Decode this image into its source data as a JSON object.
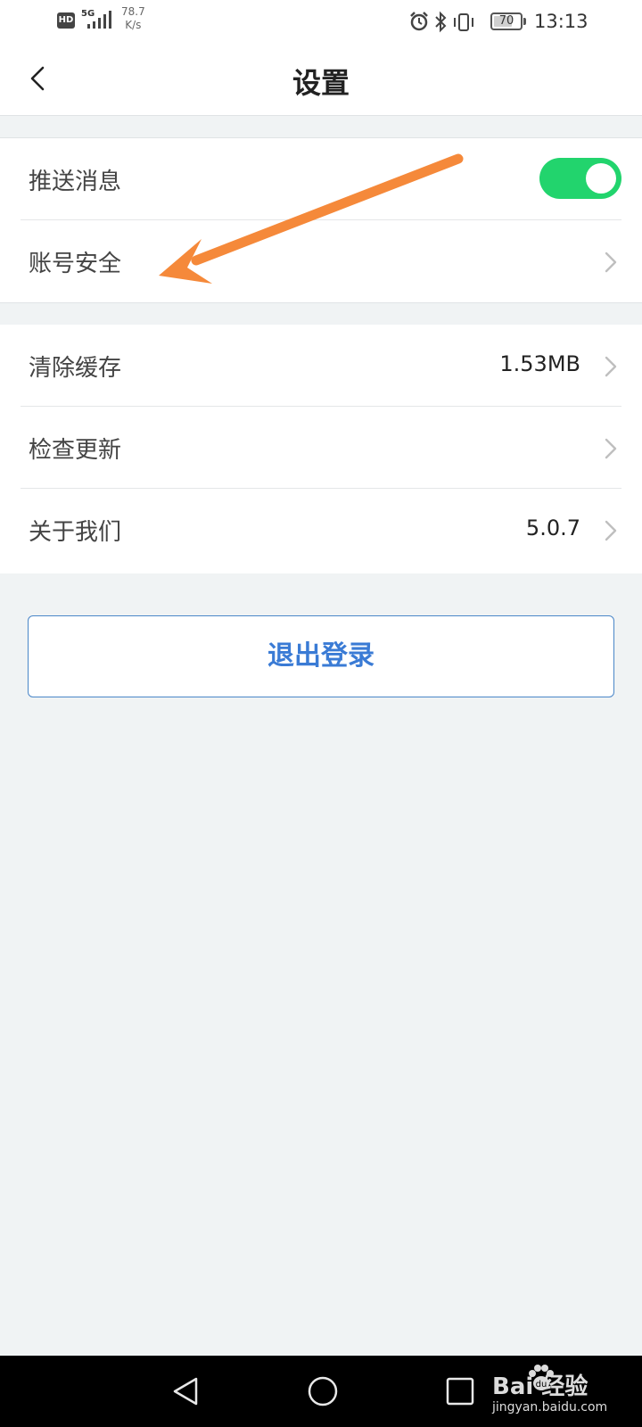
{
  "status_bar": {
    "hd": "HD",
    "network": "5G",
    "speed_value": "78.7",
    "speed_unit": "K/s",
    "battery_level": "70",
    "time": "13:13"
  },
  "header": {
    "title": "设置"
  },
  "settings_group_1": {
    "push_messages_label": "推送消息",
    "push_messages_enabled": true,
    "account_security_label": "账号安全"
  },
  "settings_group_2": {
    "clear_cache_label": "清除缓存",
    "cache_size": "1.53MB",
    "check_update_label": "检查更新",
    "about_label": "关于我们",
    "version": "5.0.7"
  },
  "logout_label": "退出登录",
  "watermark": {
    "brand": "Bai  经验",
    "url": "jingyan.baidu.com"
  },
  "colors": {
    "toggle_on": "#22d46d",
    "accent_blue": "#3a7bd5",
    "annotation_arrow": "#f5893a",
    "page_background": "#f0f3f4"
  }
}
